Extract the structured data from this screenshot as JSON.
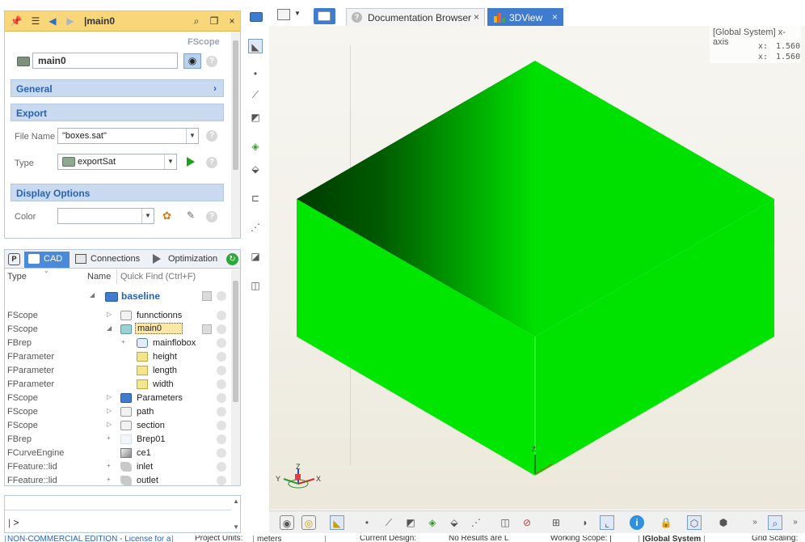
{
  "property_panel": {
    "title": "|main0",
    "scope_tag": "FScope",
    "name_value": "main0",
    "sections": {
      "general": "General",
      "export": "Export",
      "display": "Display Options"
    },
    "file_name_label": "File Name",
    "file_name_value": "\"boxes.sat\"",
    "type_label": "Type",
    "type_value": "exportSat",
    "color_label": "Color"
  },
  "tree_panel": {
    "tabs": [
      "CAD",
      "Connections",
      "Optimization"
    ],
    "col_type": "Type",
    "col_name": "Name",
    "quick_find": "Quick Find (Ctrl+F)",
    "root": "baseline",
    "rows": [
      {
        "type": "FScope",
        "name": "funnctionns",
        "exp": "▷",
        "icon": "white",
        "level": 0
      },
      {
        "type": "FScope",
        "name": "main0",
        "exp": "◢",
        "icon": "teal",
        "level": 0
      },
      {
        "type": "FBrep",
        "name": "mainflobox",
        "exp": "+",
        "icon": "brep",
        "level": 1
      },
      {
        "type": "FParameter",
        "name": "height",
        "exp": "",
        "icon": "param",
        "level": 1
      },
      {
        "type": "FParameter",
        "name": "length",
        "exp": "",
        "icon": "param",
        "level": 1
      },
      {
        "type": "FParameter",
        "name": "width",
        "exp": "",
        "icon": "param",
        "level": 1
      },
      {
        "type": "FScope",
        "name": "Parameters",
        "exp": "▷",
        "icon": "blue",
        "level": 0
      },
      {
        "type": "FScope",
        "name": "path",
        "exp": "▷",
        "icon": "white",
        "level": 0
      },
      {
        "type": "FScope",
        "name": "section",
        "exp": "▷",
        "icon": "white",
        "level": 0
      },
      {
        "type": "FBrep",
        "name": "Brep01",
        "exp": "+",
        "icon": "faint",
        "level": 0
      },
      {
        "type": "FCurveEngine",
        "name": "ce1",
        "exp": "",
        "icon": "curve",
        "level": 0
      },
      {
        "type": "FFeature::lid",
        "name": "inlet",
        "exp": "+",
        "icon": "feature",
        "level": 0
      },
      {
        "type": "FFeature::lid",
        "name": "outlet",
        "exp": "+",
        "icon": "feature",
        "level": 0
      }
    ]
  },
  "console": {
    "prompt": ">"
  },
  "view_tabs": [
    "Documentation Browser",
    "3DView"
  ],
  "readout": {
    "title": "[Global System] x-axis",
    "line1_label": "x:",
    "line1_value": "1.560",
    "line2_label": "x:",
    "line2_value": "1.560"
  },
  "axes": {
    "x": "X",
    "y": "Y",
    "z": "Z"
  },
  "statusbar": {
    "edition": "NON-COMMERCIAL EDITION - License for a",
    "units_label": "Project Units:",
    "units_value": "meters",
    "design_label": "Current Design:",
    "results_label": "No Results are L",
    "scope_label": "Working Scope: |",
    "system_label": "|Global System",
    "grid_label": "Grid Scaling:"
  },
  "colors": {
    "accent": "#3f7ccf",
    "toolbar_gold": "#f7d77a",
    "box_green": "#00e500"
  }
}
